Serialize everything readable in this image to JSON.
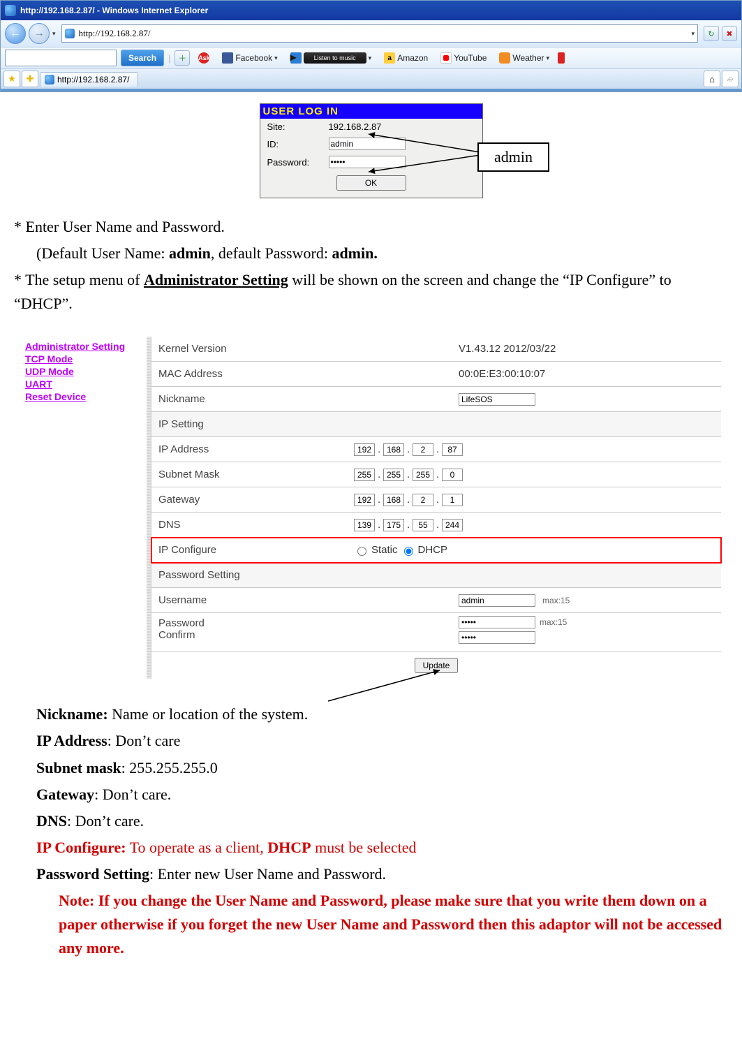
{
  "ie": {
    "title": "http://192.168.2.87/ - Windows Internet Explorer",
    "url": "http://192.168.2.87/",
    "search_button": "Search",
    "toolbar": {
      "facebook": "Facebook",
      "listen": "Listen to music",
      "amazon": "Amazon",
      "youtube": "YouTube",
      "weather": "Weather"
    },
    "tab_label": "http://192.168.2.87/"
  },
  "login": {
    "header": "USER LOG IN",
    "site_label": "Site:",
    "site_value": "192.168.2.87",
    "id_label": "ID:",
    "id_value": "admin",
    "pw_label": "Password:",
    "pw_value": "•••••",
    "ok_label": "OK",
    "callout": "admin"
  },
  "doc": {
    "p1": "* Enter User Name and Password.",
    "p2a": "(Default User Name: ",
    "p2b": "admin",
    "p2c": ", default Password: ",
    "p2d": "admin.",
    "p3a": "* The setup menu of ",
    "p3b": "Administrator Setting",
    "p3c": " will be shown on the screen and change the “IP Configure” to “DHCP”.",
    "nickname_l": "Nickname:",
    "nickname_v": " Name or location of the system.",
    "ipaddr_l": "IP Address",
    "ipaddr_v": ": Don’t care",
    "subnet_l": "Subnet mask",
    "subnet_v": ": 255.255.255.0",
    "gateway_l": "Gateway",
    "gateway_v": ": Don’t care.",
    "dns_l": "DNS",
    "dns_v": ": Don’t care.",
    "ipconf_l": "IP Configure:",
    "ipconf_v": " To operate as a client, ",
    "ipconf_b": "DHCP",
    "ipconf_v2": " must be selected",
    "pwset_l": "Password Setting",
    "pwset_v": ": Enter new User Name and Password.",
    "note": "Note: If you change the User Name and Password, please make sure that you write them down on a paper otherwise if you forget the new User Name and Password then this adaptor will not be accessed any more."
  },
  "side_links": [
    "Administrator Setting",
    "TCP Mode",
    "UDP Mode",
    "UART",
    "Reset Device"
  ],
  "admin": {
    "rows": {
      "kernel_l": "Kernel Version",
      "kernel_v": "V1.43.12 2012/03/22",
      "mac_l": "MAC Address",
      "mac_v": "00:0E:E3:00:10:07",
      "nick_l": "Nickname",
      "nick_v": "LifeSOS",
      "ipset_l": "IP Setting",
      "ip_l": "IP Address",
      "ip": [
        "192",
        "168",
        "2",
        "87"
      ],
      "sub_l": "Subnet Mask",
      "sub": [
        "255",
        "255",
        "255",
        "0"
      ],
      "gw_l": "Gateway",
      "gw": [
        "192",
        "168",
        "2",
        "1"
      ],
      "dns_l": "DNS",
      "dns": [
        "139",
        "175",
        "55",
        "244"
      ],
      "ipc_l": "IP Configure",
      "ipc_static": "Static",
      "ipc_dhcp": "DHCP",
      "pwhdr": "Password Setting",
      "user_l": "Username",
      "user_v": "admin",
      "max": "max:15",
      "pw_l": "Password",
      "conf_l": "Confirm",
      "pw_v": "•••••"
    },
    "update": "Update"
  }
}
